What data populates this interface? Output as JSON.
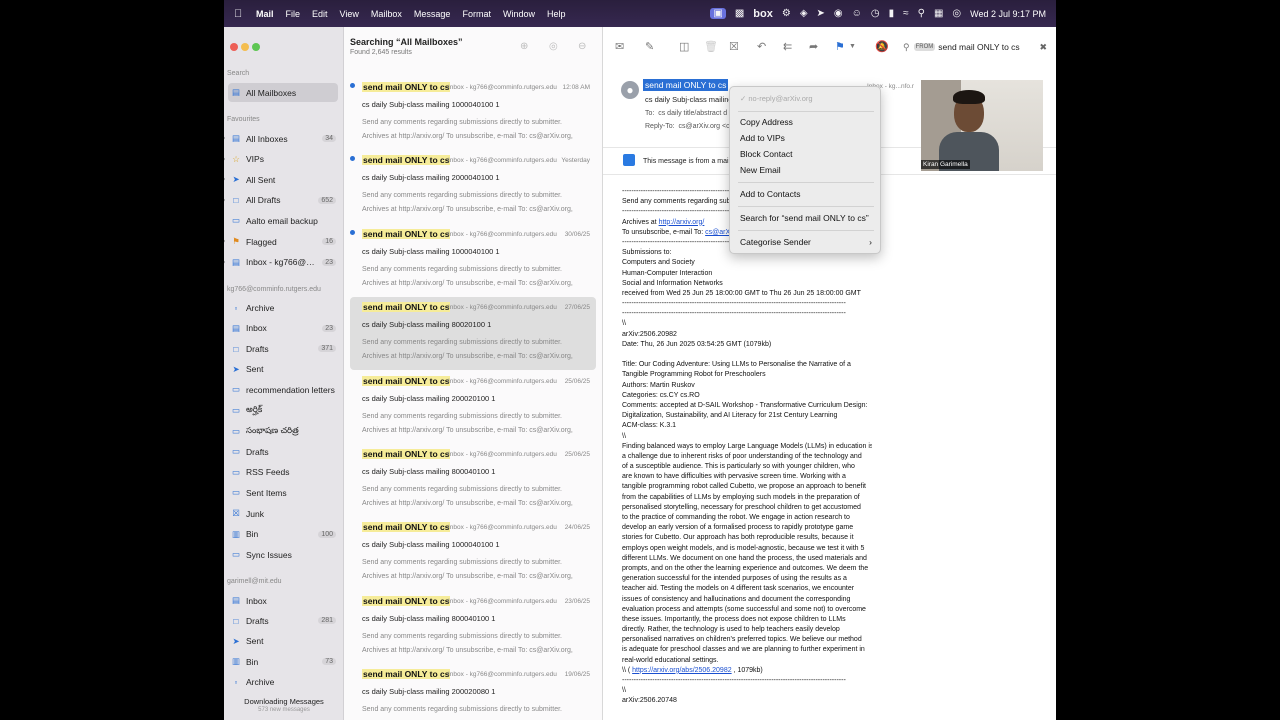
{
  "menubar": {
    "app": "Mail",
    "menus": [
      "File",
      "Edit",
      "View",
      "Mailbox",
      "Message",
      "Format",
      "Window",
      "Help"
    ],
    "box_label": "box",
    "clock": "Wed 2 Jul  9:17 PM"
  },
  "sidebar": {
    "search_label": "Search",
    "all_mailboxes": "All Mailboxes",
    "favourites_label": "Favourites",
    "favourites": [
      {
        "label": "All Inboxes",
        "count": "34",
        "icon": "tray-icon"
      },
      {
        "label": "VIPs",
        "count": "",
        "icon": "star-icon"
      },
      {
        "label": "All Sent",
        "count": "",
        "icon": "paperplane-icon"
      },
      {
        "label": "All Drafts",
        "count": "652",
        "icon": "document-icon"
      },
      {
        "label": "Aalto email backup",
        "count": "",
        "icon": "folder-icon"
      },
      {
        "label": "Flagged",
        "count": "16",
        "icon": "flag-icon"
      },
      {
        "label": "Inbox - kg766@co...",
        "count": "23",
        "icon": "tray-icon"
      }
    ],
    "account1_label": "kg766@comminfo.rutgers.edu",
    "account1": [
      {
        "label": "Archive",
        "count": "",
        "icon": "archive-icon"
      },
      {
        "label": "Inbox",
        "count": "23",
        "icon": "tray-icon"
      },
      {
        "label": "Drafts",
        "count": "371",
        "icon": "document-icon"
      },
      {
        "label": "Sent",
        "count": "",
        "icon": "paperplane-icon"
      },
      {
        "label": "recommendation letters",
        "count": "",
        "icon": "folder-icon"
      },
      {
        "label": "అర్హిక్",
        "count": "",
        "icon": "folder-icon"
      },
      {
        "label": "సంభాషణ చరిత్ర",
        "count": "",
        "icon": "folder-icon"
      },
      {
        "label": "Drafts",
        "count": "",
        "icon": "folder-icon"
      },
      {
        "label": "RSS Feeds",
        "count": "",
        "icon": "folder-icon"
      },
      {
        "label": "Sent Items",
        "count": "",
        "icon": "folder-icon"
      },
      {
        "label": "Junk",
        "count": "",
        "icon": "junk-icon"
      },
      {
        "label": "Bin",
        "count": "100",
        "icon": "trash-icon"
      },
      {
        "label": "Sync Issues",
        "count": "",
        "icon": "folder-icon"
      }
    ],
    "account2_label": "garimell@mit.edu",
    "account2": [
      {
        "label": "Inbox",
        "count": "",
        "icon": "tray-icon"
      },
      {
        "label": "Drafts",
        "count": "281",
        "icon": "document-icon"
      },
      {
        "label": "Sent",
        "count": "",
        "icon": "paperplane-icon"
      },
      {
        "label": "Bin",
        "count": "73",
        "icon": "trash-icon"
      },
      {
        "label": "Archive",
        "count": "",
        "icon": "archive-icon"
      }
    ],
    "downloading": "Downloading Messages",
    "downloading_sub": "573 new messages"
  },
  "list": {
    "title": "Searching “All Mailboxes”",
    "subtitle": "Found 2,645 results",
    "messages": [
      {
        "from": "send mail ONLY to cs",
        "mailbox": "Inbox - kg766@comminfo.rutgers.edu",
        "date": "12:08 AM",
        "subject": "cs daily Subj-class mailing 1000040100 1",
        "preview": "Send any comments regarding submissions directly to submitter. Archives at http://arxiv.org/ To unsubscribe, e-mail To: cs@arXiv.org, Subject: cancel Su...",
        "unread": true
      },
      {
        "from": "send mail ONLY to cs",
        "mailbox": "Inbox - kg766@comminfo.rutgers.edu",
        "date": "Yesterday",
        "subject": "cs daily Subj-class mailing 2000040100 1",
        "preview": "Send any comments regarding submissions directly to submitter. Archives at http://arxiv.org/ To unsubscribe, e-mail To: cs@arXiv.org, Subject: cancel Su...",
        "unread": true
      },
      {
        "from": "send mail ONLY to cs",
        "mailbox": "Inbox - kg766@comminfo.rutgers.edu",
        "date": "30/06/25",
        "subject": "cs daily Subj-class mailing 1000040100 1",
        "preview": "Send any comments regarding submissions directly to submitter. Archives at http://arxiv.org/ To unsubscribe, e-mail To: cs@arXiv.org, Subject: cancel Su...",
        "unread": true
      },
      {
        "from": "send mail ONLY to cs",
        "mailbox": "Inbox - kg766@comminfo.rutgers.edu",
        "date": "27/06/25",
        "subject": "cs daily Subj-class mailing 80020100 1",
        "preview": "Send any comments regarding submissions directly to submitter. Archives at http://arxiv.org/ To unsubscribe, e-mail To: cs@arXiv.org, Subject: cancel Su...",
        "unread": false
      },
      {
        "from": "send mail ONLY to cs",
        "mailbox": "Inbox - kg766@comminfo.rutgers.edu",
        "date": "25/06/25",
        "subject": "cs daily Subj-class mailing 200020100 1",
        "preview": "Send any comments regarding submissions directly to submitter. Archives at http://arxiv.org/ To unsubscribe, e-mail To: cs@arXiv.org, Subject: cancel Su...",
        "unread": false
      },
      {
        "from": "send mail ONLY to cs",
        "mailbox": "Inbox - kg766@comminfo.rutgers.edu",
        "date": "25/06/25",
        "subject": "cs daily Subj-class mailing 800040100 1",
        "preview": "Send any comments regarding submissions directly to submitter. Archives at http://arxiv.org/ To unsubscribe, e-mail To: cs@arXiv.org, Subject: cancel Su...",
        "unread": false
      },
      {
        "from": "send mail ONLY to cs",
        "mailbox": "Inbox - kg766@comminfo.rutgers.edu",
        "date": "24/06/25",
        "subject": "cs daily Subj-class mailing 1000040100 1",
        "preview": "Send any comments regarding submissions directly to submitter. Archives at http://arxiv.org/ To unsubscribe, e-mail To: cs@arXiv.org, Subject: cancel Su...",
        "unread": false
      },
      {
        "from": "send mail ONLY to cs",
        "mailbox": "Inbox - kg766@comminfo.rutgers.edu",
        "date": "23/06/25",
        "subject": "cs daily Subj-class mailing 800040100 1",
        "preview": "Send any comments regarding submissions directly to submitter. Archives at http://arxiv.org/ To unsubscribe, e-mail To: cs@arXiv.org, Subject: cancel Su...",
        "unread": false
      },
      {
        "from": "send mail ONLY to cs",
        "mailbox": "Inbox - kg766@comminfo.rutgers.edu",
        "date": "19/06/25",
        "subject": "cs daily Subj-class mailing 200020080 1",
        "preview": "Send any comments regarding submissions directly to submitter. Archives at",
        "unread": false
      }
    ]
  },
  "reader": {
    "search_pill": "FROM",
    "search_value": "send mail ONLY to cs",
    "from": "send mail ONLY to cs",
    "subject": "cs daily Subj-class mailing",
    "to_label": "To:",
    "to_value": "cs daily title/abstract d",
    "reply_label": "Reply-To:",
    "reply_value": "cs@arXiv.org <c",
    "mailbox": "Inbox - kg...nfo.r",
    "banner": "This message is from a mailin",
    "body": [
      {
        "t": "------------------------------------------------------------------------------------------------"
      },
      {
        "t": "Send any comments regarding subm"
      },
      {
        "t": "------------------------------------------------------------------------------------------------"
      },
      {
        "t": "Archives at ",
        "link": "http://arxiv.org/"
      },
      {
        "t": "To unsubscribe, e-mail To: ",
        "link": "cs@arXiv"
      },
      {
        "t": "------------------------------------------------------------------------------------------------"
      },
      {
        "t": "Submissions to:"
      },
      {
        "t": "Computers and Society"
      },
      {
        "t": "Human-Computer Interaction"
      },
      {
        "t": "Social and Information Networks"
      },
      {
        "t": "received from  Wed 25 Jun 25 18:00:00 GMT  to  Thu 26 Jun 25 18:00:00 GMT"
      },
      {
        "t": "------------------------------------------------------------------------------------------------"
      },
      {
        "t": "------------------------------------------------------------------------------------------------"
      },
      {
        "t": "\\\\"
      },
      {
        "t": "arXiv:2506.20982"
      },
      {
        "t": "Date: Thu, 26 Jun 2025 03:54:25 GMT   (1079kb)"
      },
      {
        "t": ""
      },
      {
        "t": "Title: Our Coding Adventure: Using LLMs to Personalise the Narrative of a"
      },
      {
        "t": "  Tangible Programming Robot for Preschoolers"
      },
      {
        "t": "Authors: Martin Ruskov"
      },
      {
        "t": "Categories: cs.CY cs.RO"
      },
      {
        "t": "Comments: accepted at D-SAIL Workshop - Transformative Curriculum Design:"
      },
      {
        "t": "  Digitalization, Sustainability, and AI Literacy for 21st Century Learning"
      },
      {
        "t": "ACM-class: K.3.1"
      },
      {
        "t": "\\\\"
      },
      {
        "t": "  Finding balanced ways to employ Large Language Models (LLMs) in education is"
      },
      {
        "t": "a challenge due to inherent risks of poor understanding of the technology and"
      },
      {
        "t": "of a susceptible audience. This is particularly so with younger children, who"
      },
      {
        "t": "are known to have difficulties with pervasive screen time. Working with a"
      },
      {
        "t": "tangible programming robot called Cubetto, we propose an approach to benefit"
      },
      {
        "t": "from the capabilities of LLMs by employing such models in the preparation of"
      },
      {
        "t": "personalised storytelling, necessary for preschool children to get accustomed"
      },
      {
        "t": "to the practice of commanding the robot. We engage in action research to"
      },
      {
        "t": "develop an early version of a formalised process to rapidly prototype game"
      },
      {
        "t": "stories for Cubetto. Our approach has both reproducible results, because it"
      },
      {
        "t": "employs open weight models, and is model-agnostic, because we test it with 5"
      },
      {
        "t": "different LLMs. We document on one hand the process, the used materials and"
      },
      {
        "t": "prompts, and on the other the learning experience and outcomes. We deem the"
      },
      {
        "t": "generation successful for the intended purposes of using the results as a"
      },
      {
        "t": "teacher aid. Testing the models on 4 different task scenarios, we encounter"
      },
      {
        "t": "issues of consistency and hallucinations and document the corresponding"
      },
      {
        "t": "evaluation process and attempts (some successful and some not) to overcome"
      },
      {
        "t": "these issues. Importantly, the process does not expose children to LLMs"
      },
      {
        "t": "directly. Rather, the technology is used to help teachers easily develop"
      },
      {
        "t": "personalised narratives on children's preferred topics. We believe our method"
      },
      {
        "t": "is adequate for preschool classes and we are planning to further experiment in"
      },
      {
        "t": "real-world educational settings."
      },
      {
        "t": "\\\\ ( ",
        "link": "https://arxiv.org/abs/2506.20982",
        "after": " ,  1079kb)"
      },
      {
        "t": "------------------------------------------------------------------------------------------------"
      },
      {
        "t": "\\\\"
      },
      {
        "t": "arXiv:2506.20748"
      }
    ]
  },
  "context_menu": {
    "header": "✓ no-reply@arXiv.org",
    "items": [
      "Copy Address",
      "Add to VIPs",
      "Block Contact",
      "New Email",
      "Add to Contacts",
      "Search for “send mail ONLY to cs”",
      "Categorise Sender"
    ],
    "submenu_arrow": "›"
  },
  "webcam": {
    "name": "Kiran Garimella"
  },
  "colors": {
    "accent": "#2a6fd4",
    "highlight": "#f6ec99",
    "menubar": "#2a1f3d"
  }
}
